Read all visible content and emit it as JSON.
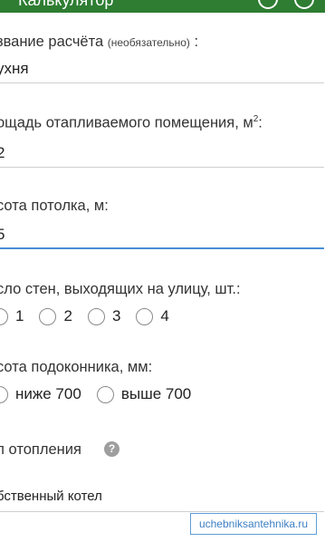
{
  "app": {
    "title": "Калькулятор"
  },
  "form": {
    "name": {
      "label": "звание расчёта",
      "label_hint": "(необязательно)",
      "label_suffix": ":",
      "value": "ухня"
    },
    "area": {
      "label": "ощадь отапливаемого помещения, м",
      "label_sup": "2",
      "label_suffix": ":",
      "value": "2"
    },
    "ceiling": {
      "label": "сота потолка, м:",
      "value": "5"
    },
    "walls": {
      "label": "сло стен, выходящих на улицу, шт.:",
      "options": [
        "1",
        "2",
        "3",
        "4"
      ]
    },
    "sill": {
      "label": "сота подоконника, мм:",
      "options": [
        "ниже 700",
        "выше 700"
      ]
    },
    "heating": {
      "label": "п отопления",
      "help_glyph": "?",
      "value": "бственный котел"
    }
  },
  "watermark": "uchebniksantehnika.ru",
  "colors": {
    "appbar": "#2e7d32",
    "active_field": "#4a8fd6",
    "watermark": "#3d7fc4"
  }
}
